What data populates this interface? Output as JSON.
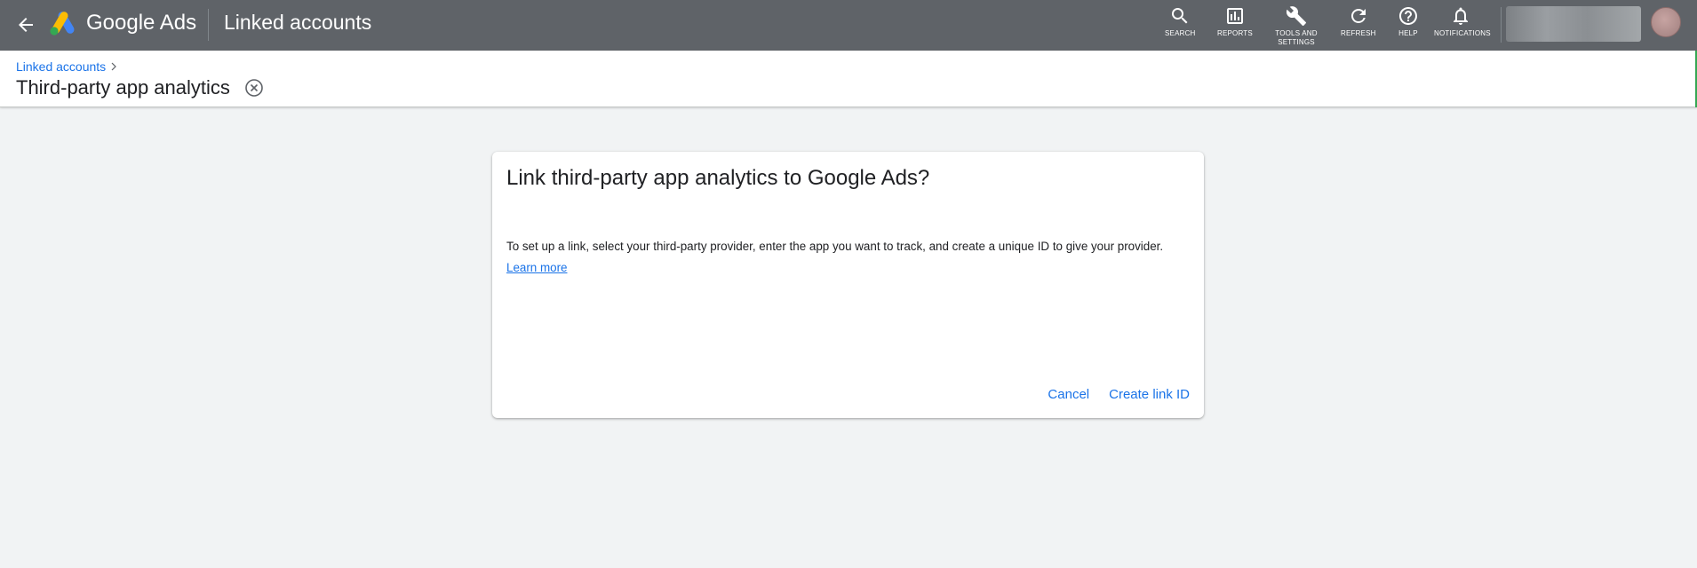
{
  "topbar": {
    "brand": "Google Ads",
    "section_title": "Linked accounts",
    "tools": [
      {
        "label": "SEARCH",
        "icon": "search-icon"
      },
      {
        "label": "REPORTS",
        "icon": "reports-icon"
      },
      {
        "label": "TOOLS AND SETTINGS",
        "icon": "wrench-icon"
      },
      {
        "label": "REFRESH",
        "icon": "refresh-icon"
      },
      {
        "label": "HELP",
        "icon": "help-icon"
      },
      {
        "label": "NOTIFICATIONS",
        "icon": "bell-icon"
      }
    ]
  },
  "header": {
    "breadcrumb": "Linked accounts",
    "title": "Third-party app analytics"
  },
  "dialog": {
    "title": "Link third-party app analytics to Google Ads?",
    "body": "To set up a link, select your third-party provider, enter the app you want to track, and create a unique ID to give your provider. ",
    "learn_more": "Learn more",
    "cancel_label": "Cancel",
    "create_label": "Create link ID"
  },
  "colors": {
    "topbar_bg": "#5f6368",
    "accent": "#1a73e8",
    "page_bg": "#f1f3f4"
  }
}
